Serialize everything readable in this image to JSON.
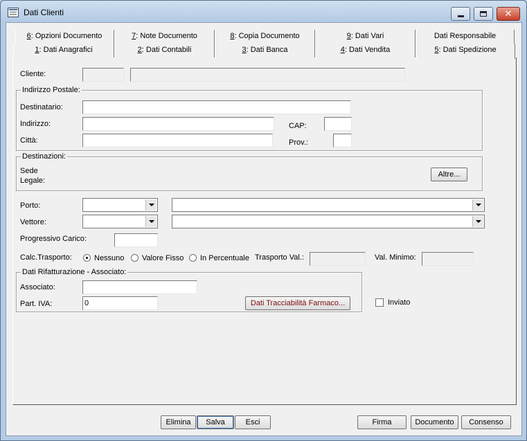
{
  "window": {
    "title": "Dati Clienti"
  },
  "tabs": {
    "row1": [
      {
        "key": "6",
        "label": ": Opzioni Documento"
      },
      {
        "key": "7",
        "label": ": Note Documento"
      },
      {
        "key": "8",
        "label": ": Copia Documento"
      },
      {
        "key": "9",
        "label": ": Dati Vari"
      },
      {
        "key": "",
        "label": "Dati Responsabile"
      }
    ],
    "row2": [
      {
        "key": "1",
        "label": ": Dati Anagrafici"
      },
      {
        "key": "2",
        "label": ": Dati Contabili"
      },
      {
        "key": "3",
        "label": ": Dati Banca"
      },
      {
        "key": "4",
        "label": ": Dati Vendita"
      },
      {
        "key": "5",
        "label": ": Dati Spedizione"
      }
    ],
    "active": "5: Dati Spedizione"
  },
  "form": {
    "cliente_label": "Cliente:",
    "cliente_code": "",
    "cliente_name": "",
    "indirizzo_group": "Indirizzo Postale:",
    "destinatario_label": "Destinatario:",
    "destinatario_value": "",
    "indirizzo_label": "Indirizzo:",
    "indirizzo_value": "",
    "cap_label": "CAP:",
    "cap_value": "",
    "citta_label": "Città:",
    "citta_value": "",
    "prov_label": "Prov.:",
    "prov_value": "",
    "destinazioni_group": "Destinazioni:",
    "sede_line1": "Sede",
    "sede_line2": "Legale:",
    "altre_button": "Altre...",
    "porto_label": "Porto:",
    "porto_code": "",
    "porto_desc": "",
    "vettore_label": "Vettore:",
    "vettore_code": "",
    "vettore_desc": "",
    "progressivo_label": "Progressivo Carico:",
    "progressivo_value": "",
    "calc_label": "Calc.Trasporto:",
    "radio_nessuno": "Nessuno",
    "radio_fisso": "Valore Fisso",
    "radio_percentuale": "In Percentuale",
    "radio_selected": "Nessuno",
    "trasporto_label": "Trasporto Val.:",
    "trasporto_value": "",
    "minimo_label": "Val. Minimo:",
    "minimo_value": "",
    "rifatt_group": "Dati Rifatturazione - Associato:",
    "associato_label": "Associato:",
    "associato_value": "",
    "partiva_label": "Part. IVA:",
    "partiva_value": "0",
    "tracciabilita_button": "Dati Tracciabilità Farmaco...",
    "inviato_label": "Inviato",
    "inviato_checked": false
  },
  "footer": {
    "elimina": "Elimina",
    "salva": "Salva",
    "esci": "Esci",
    "firma": "Firma",
    "documento": "Documento",
    "consenso": "Consenso"
  }
}
